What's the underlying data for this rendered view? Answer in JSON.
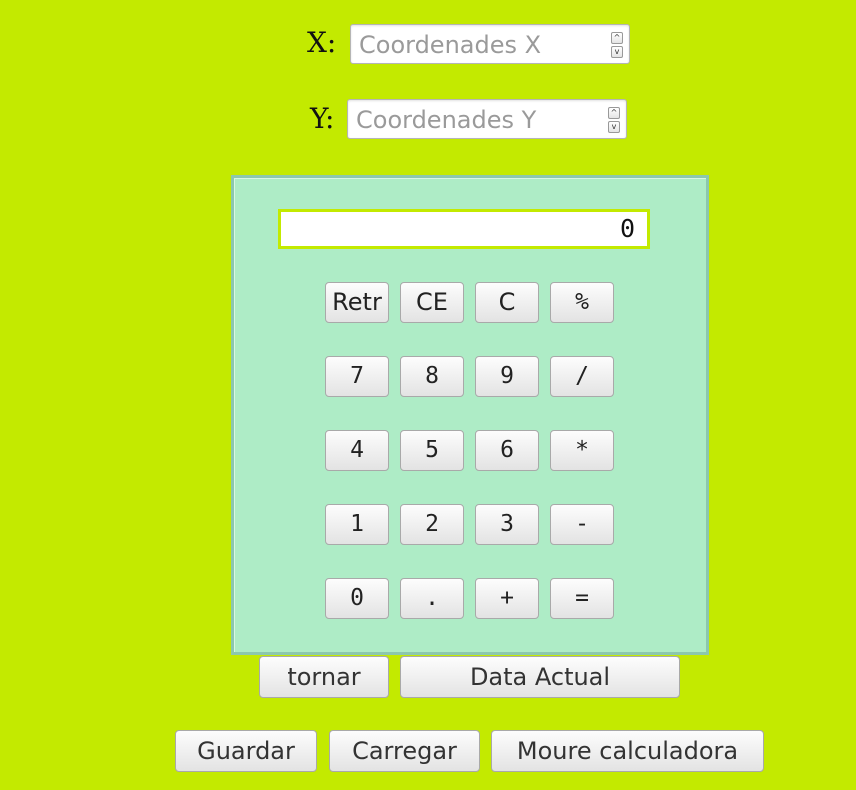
{
  "coords": {
    "x_label": "X:",
    "x_placeholder": "Coordenades X",
    "y_label": "Y:",
    "y_placeholder": "Coordenades Y"
  },
  "spinner": {
    "up_icon": "arrow-up-icon",
    "down_icon": "arrow-down-icon",
    "up_glyph": "^",
    "down_glyph": "v"
  },
  "calculator": {
    "display": "0",
    "rows": [
      [
        "Retr",
        "CE",
        "C",
        "%"
      ],
      [
        "7",
        "8",
        "9",
        "/"
      ],
      [
        "4",
        "5",
        "6",
        "*"
      ],
      [
        "1",
        "2",
        "3",
        "-"
      ],
      [
        "0",
        ".",
        "+",
        "="
      ]
    ]
  },
  "actions": {
    "tornar": "tornar",
    "data_actual": "Data Actual",
    "guardar": "Guardar",
    "carregar": "Carregar",
    "moure": "Moure calculadora"
  },
  "colors": {
    "background": "#c3ea00",
    "panel": "#aeecc6",
    "panel_border": "#8cc8ad"
  }
}
